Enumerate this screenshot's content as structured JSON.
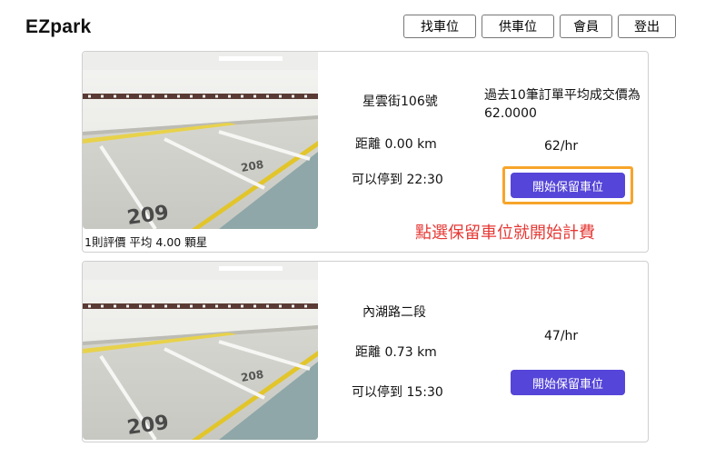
{
  "brand": "EZpark",
  "nav": {
    "find": "找車位",
    "provide": "供車位",
    "member": "會員",
    "logout": "登出"
  },
  "listings": [
    {
      "address": "星雲街106號",
      "distance": "距離 0.00 km",
      "until": "可以停到 22:30",
      "avg_note": "過去10筆訂單平均成交價為62.0000",
      "price": "62/hr",
      "reserve_label": "開始保留車位",
      "rating": "1則評價 平均 4.00 顆星",
      "hint": "點選保留車位就開始計費"
    },
    {
      "address": "內湖路二段",
      "distance": "距離 0.73 km",
      "until": "可以停到 15:30",
      "price": "47/hr",
      "reserve_label": "開始保留車位"
    }
  ],
  "colors": {
    "reserve_button": "#5545d8",
    "highlight": "#f7a52b",
    "hint_text": "#e53935"
  }
}
